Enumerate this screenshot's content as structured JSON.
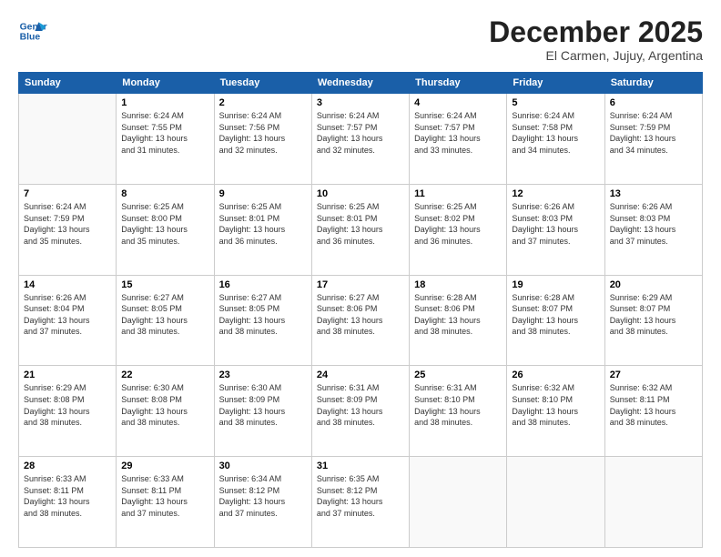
{
  "logo": {
    "line1": "General",
    "line2": "Blue"
  },
  "title": "December 2025",
  "subtitle": "El Carmen, Jujuy, Argentina",
  "weekdays": [
    "Sunday",
    "Monday",
    "Tuesday",
    "Wednesday",
    "Thursday",
    "Friday",
    "Saturday"
  ],
  "weeks": [
    [
      {
        "day": "",
        "info": ""
      },
      {
        "day": "1",
        "info": "Sunrise: 6:24 AM\nSunset: 7:55 PM\nDaylight: 13 hours\nand 31 minutes."
      },
      {
        "day": "2",
        "info": "Sunrise: 6:24 AM\nSunset: 7:56 PM\nDaylight: 13 hours\nand 32 minutes."
      },
      {
        "day": "3",
        "info": "Sunrise: 6:24 AM\nSunset: 7:57 PM\nDaylight: 13 hours\nand 32 minutes."
      },
      {
        "day": "4",
        "info": "Sunrise: 6:24 AM\nSunset: 7:57 PM\nDaylight: 13 hours\nand 33 minutes."
      },
      {
        "day": "5",
        "info": "Sunrise: 6:24 AM\nSunset: 7:58 PM\nDaylight: 13 hours\nand 34 minutes."
      },
      {
        "day": "6",
        "info": "Sunrise: 6:24 AM\nSunset: 7:59 PM\nDaylight: 13 hours\nand 34 minutes."
      }
    ],
    [
      {
        "day": "7",
        "info": "Sunrise: 6:24 AM\nSunset: 7:59 PM\nDaylight: 13 hours\nand 35 minutes."
      },
      {
        "day": "8",
        "info": "Sunrise: 6:25 AM\nSunset: 8:00 PM\nDaylight: 13 hours\nand 35 minutes."
      },
      {
        "day": "9",
        "info": "Sunrise: 6:25 AM\nSunset: 8:01 PM\nDaylight: 13 hours\nand 36 minutes."
      },
      {
        "day": "10",
        "info": "Sunrise: 6:25 AM\nSunset: 8:01 PM\nDaylight: 13 hours\nand 36 minutes."
      },
      {
        "day": "11",
        "info": "Sunrise: 6:25 AM\nSunset: 8:02 PM\nDaylight: 13 hours\nand 36 minutes."
      },
      {
        "day": "12",
        "info": "Sunrise: 6:26 AM\nSunset: 8:03 PM\nDaylight: 13 hours\nand 37 minutes."
      },
      {
        "day": "13",
        "info": "Sunrise: 6:26 AM\nSunset: 8:03 PM\nDaylight: 13 hours\nand 37 minutes."
      }
    ],
    [
      {
        "day": "14",
        "info": "Sunrise: 6:26 AM\nSunset: 8:04 PM\nDaylight: 13 hours\nand 37 minutes."
      },
      {
        "day": "15",
        "info": "Sunrise: 6:27 AM\nSunset: 8:05 PM\nDaylight: 13 hours\nand 38 minutes."
      },
      {
        "day": "16",
        "info": "Sunrise: 6:27 AM\nSunset: 8:05 PM\nDaylight: 13 hours\nand 38 minutes."
      },
      {
        "day": "17",
        "info": "Sunrise: 6:27 AM\nSunset: 8:06 PM\nDaylight: 13 hours\nand 38 minutes."
      },
      {
        "day": "18",
        "info": "Sunrise: 6:28 AM\nSunset: 8:06 PM\nDaylight: 13 hours\nand 38 minutes."
      },
      {
        "day": "19",
        "info": "Sunrise: 6:28 AM\nSunset: 8:07 PM\nDaylight: 13 hours\nand 38 minutes."
      },
      {
        "day": "20",
        "info": "Sunrise: 6:29 AM\nSunset: 8:07 PM\nDaylight: 13 hours\nand 38 minutes."
      }
    ],
    [
      {
        "day": "21",
        "info": "Sunrise: 6:29 AM\nSunset: 8:08 PM\nDaylight: 13 hours\nand 38 minutes."
      },
      {
        "day": "22",
        "info": "Sunrise: 6:30 AM\nSunset: 8:08 PM\nDaylight: 13 hours\nand 38 minutes."
      },
      {
        "day": "23",
        "info": "Sunrise: 6:30 AM\nSunset: 8:09 PM\nDaylight: 13 hours\nand 38 minutes."
      },
      {
        "day": "24",
        "info": "Sunrise: 6:31 AM\nSunset: 8:09 PM\nDaylight: 13 hours\nand 38 minutes."
      },
      {
        "day": "25",
        "info": "Sunrise: 6:31 AM\nSunset: 8:10 PM\nDaylight: 13 hours\nand 38 minutes."
      },
      {
        "day": "26",
        "info": "Sunrise: 6:32 AM\nSunset: 8:10 PM\nDaylight: 13 hours\nand 38 minutes."
      },
      {
        "day": "27",
        "info": "Sunrise: 6:32 AM\nSunset: 8:11 PM\nDaylight: 13 hours\nand 38 minutes."
      }
    ],
    [
      {
        "day": "28",
        "info": "Sunrise: 6:33 AM\nSunset: 8:11 PM\nDaylight: 13 hours\nand 38 minutes."
      },
      {
        "day": "29",
        "info": "Sunrise: 6:33 AM\nSunset: 8:11 PM\nDaylight: 13 hours\nand 37 minutes."
      },
      {
        "day": "30",
        "info": "Sunrise: 6:34 AM\nSunset: 8:12 PM\nDaylight: 13 hours\nand 37 minutes."
      },
      {
        "day": "31",
        "info": "Sunrise: 6:35 AM\nSunset: 8:12 PM\nDaylight: 13 hours\nand 37 minutes."
      },
      {
        "day": "",
        "info": ""
      },
      {
        "day": "",
        "info": ""
      },
      {
        "day": "",
        "info": ""
      }
    ]
  ]
}
